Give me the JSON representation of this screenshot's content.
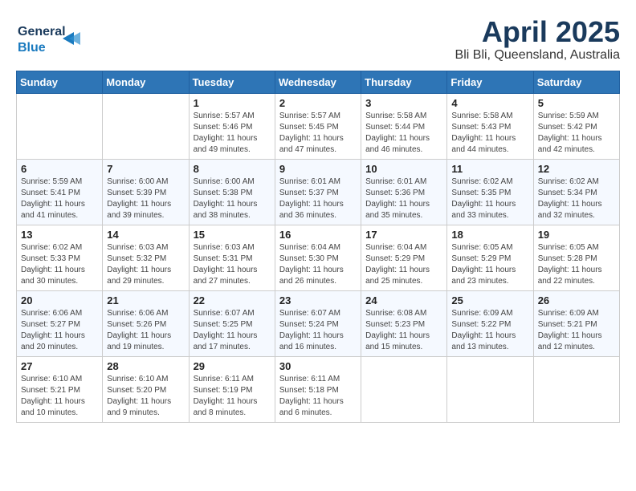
{
  "header": {
    "logo_general": "General",
    "logo_blue": "Blue",
    "month_title": "April 2025",
    "location": "Bli Bli, Queensland, Australia"
  },
  "weekdays": [
    "Sunday",
    "Monday",
    "Tuesday",
    "Wednesday",
    "Thursday",
    "Friday",
    "Saturday"
  ],
  "weeks": [
    [
      {
        "day": "",
        "info": ""
      },
      {
        "day": "",
        "info": ""
      },
      {
        "day": "1",
        "info": "Sunrise: 5:57 AM\nSunset: 5:46 PM\nDaylight: 11 hours and 49 minutes."
      },
      {
        "day": "2",
        "info": "Sunrise: 5:57 AM\nSunset: 5:45 PM\nDaylight: 11 hours and 47 minutes."
      },
      {
        "day": "3",
        "info": "Sunrise: 5:58 AM\nSunset: 5:44 PM\nDaylight: 11 hours and 46 minutes."
      },
      {
        "day": "4",
        "info": "Sunrise: 5:58 AM\nSunset: 5:43 PM\nDaylight: 11 hours and 44 minutes."
      },
      {
        "day": "5",
        "info": "Sunrise: 5:59 AM\nSunset: 5:42 PM\nDaylight: 11 hours and 42 minutes."
      }
    ],
    [
      {
        "day": "6",
        "info": "Sunrise: 5:59 AM\nSunset: 5:41 PM\nDaylight: 11 hours and 41 minutes."
      },
      {
        "day": "7",
        "info": "Sunrise: 6:00 AM\nSunset: 5:39 PM\nDaylight: 11 hours and 39 minutes."
      },
      {
        "day": "8",
        "info": "Sunrise: 6:00 AM\nSunset: 5:38 PM\nDaylight: 11 hours and 38 minutes."
      },
      {
        "day": "9",
        "info": "Sunrise: 6:01 AM\nSunset: 5:37 PM\nDaylight: 11 hours and 36 minutes."
      },
      {
        "day": "10",
        "info": "Sunrise: 6:01 AM\nSunset: 5:36 PM\nDaylight: 11 hours and 35 minutes."
      },
      {
        "day": "11",
        "info": "Sunrise: 6:02 AM\nSunset: 5:35 PM\nDaylight: 11 hours and 33 minutes."
      },
      {
        "day": "12",
        "info": "Sunrise: 6:02 AM\nSunset: 5:34 PM\nDaylight: 11 hours and 32 minutes."
      }
    ],
    [
      {
        "day": "13",
        "info": "Sunrise: 6:02 AM\nSunset: 5:33 PM\nDaylight: 11 hours and 30 minutes."
      },
      {
        "day": "14",
        "info": "Sunrise: 6:03 AM\nSunset: 5:32 PM\nDaylight: 11 hours and 29 minutes."
      },
      {
        "day": "15",
        "info": "Sunrise: 6:03 AM\nSunset: 5:31 PM\nDaylight: 11 hours and 27 minutes."
      },
      {
        "day": "16",
        "info": "Sunrise: 6:04 AM\nSunset: 5:30 PM\nDaylight: 11 hours and 26 minutes."
      },
      {
        "day": "17",
        "info": "Sunrise: 6:04 AM\nSunset: 5:29 PM\nDaylight: 11 hours and 25 minutes."
      },
      {
        "day": "18",
        "info": "Sunrise: 6:05 AM\nSunset: 5:29 PM\nDaylight: 11 hours and 23 minutes."
      },
      {
        "day": "19",
        "info": "Sunrise: 6:05 AM\nSunset: 5:28 PM\nDaylight: 11 hours and 22 minutes."
      }
    ],
    [
      {
        "day": "20",
        "info": "Sunrise: 6:06 AM\nSunset: 5:27 PM\nDaylight: 11 hours and 20 minutes."
      },
      {
        "day": "21",
        "info": "Sunrise: 6:06 AM\nSunset: 5:26 PM\nDaylight: 11 hours and 19 minutes."
      },
      {
        "day": "22",
        "info": "Sunrise: 6:07 AM\nSunset: 5:25 PM\nDaylight: 11 hours and 17 minutes."
      },
      {
        "day": "23",
        "info": "Sunrise: 6:07 AM\nSunset: 5:24 PM\nDaylight: 11 hours and 16 minutes."
      },
      {
        "day": "24",
        "info": "Sunrise: 6:08 AM\nSunset: 5:23 PM\nDaylight: 11 hours and 15 minutes."
      },
      {
        "day": "25",
        "info": "Sunrise: 6:09 AM\nSunset: 5:22 PM\nDaylight: 11 hours and 13 minutes."
      },
      {
        "day": "26",
        "info": "Sunrise: 6:09 AM\nSunset: 5:21 PM\nDaylight: 11 hours and 12 minutes."
      }
    ],
    [
      {
        "day": "27",
        "info": "Sunrise: 6:10 AM\nSunset: 5:21 PM\nDaylight: 11 hours and 10 minutes."
      },
      {
        "day": "28",
        "info": "Sunrise: 6:10 AM\nSunset: 5:20 PM\nDaylight: 11 hours and 9 minutes."
      },
      {
        "day": "29",
        "info": "Sunrise: 6:11 AM\nSunset: 5:19 PM\nDaylight: 11 hours and 8 minutes."
      },
      {
        "day": "30",
        "info": "Sunrise: 6:11 AM\nSunset: 5:18 PM\nDaylight: 11 hours and 6 minutes."
      },
      {
        "day": "",
        "info": ""
      },
      {
        "day": "",
        "info": ""
      },
      {
        "day": "",
        "info": ""
      }
    ]
  ]
}
